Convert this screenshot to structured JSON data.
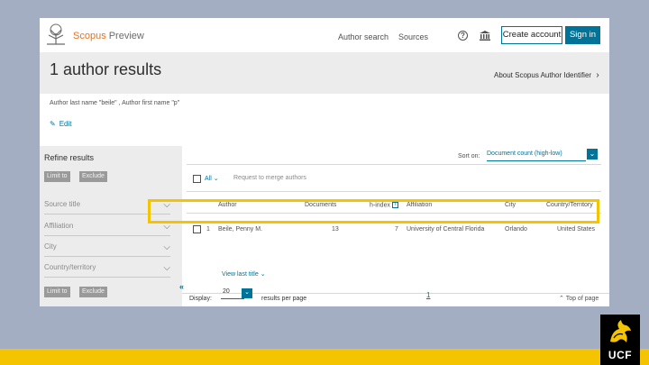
{
  "header": {
    "brand": "Scopus",
    "brand_suffix": "Preview",
    "nav": [
      "Author search",
      "Sources"
    ],
    "help_icon": "?",
    "create_account": "Create account",
    "sign_in": "Sign in"
  },
  "hero": {
    "title": "1 author results",
    "about_link": "About Scopus Author Identifier"
  },
  "query": {
    "text": "Author last name \"beile\" , Author first name \"p\"",
    "edit_label": "Edit"
  },
  "sidebar": {
    "title": "Refine results",
    "limit_label": "Limit to",
    "exclude_label": "Exclude",
    "facets": [
      "Source title",
      "Affiliation",
      "City",
      "Country/territory"
    ]
  },
  "results": {
    "sort_label": "Sort on:",
    "sort_value": "Document count (high-low)",
    "all_label": "All",
    "merge_label": "Request to merge authors",
    "columns": [
      "Author",
      "Documents",
      "h-index",
      "Affiliation",
      "City",
      "Country/Territory"
    ],
    "rows": [
      {
        "index": "1",
        "author": "Beile, Penny M.",
        "documents": "13",
        "h_index": "7",
        "affiliation": "University of Central Florida",
        "city": "Orlando",
        "country": "United States"
      }
    ],
    "view_last_title": "View last title"
  },
  "footer": {
    "display_label": "Display:",
    "display_value": "20",
    "results_per_page": "results per page",
    "page": "1",
    "top_of_page": "Top of page"
  },
  "brand_badge": {
    "text": "UCF"
  },
  "colors": {
    "accent": "#007398",
    "brand_orange": "#e9711c",
    "highlight": "#f5c400",
    "slide_bg": "#a3aec3"
  }
}
